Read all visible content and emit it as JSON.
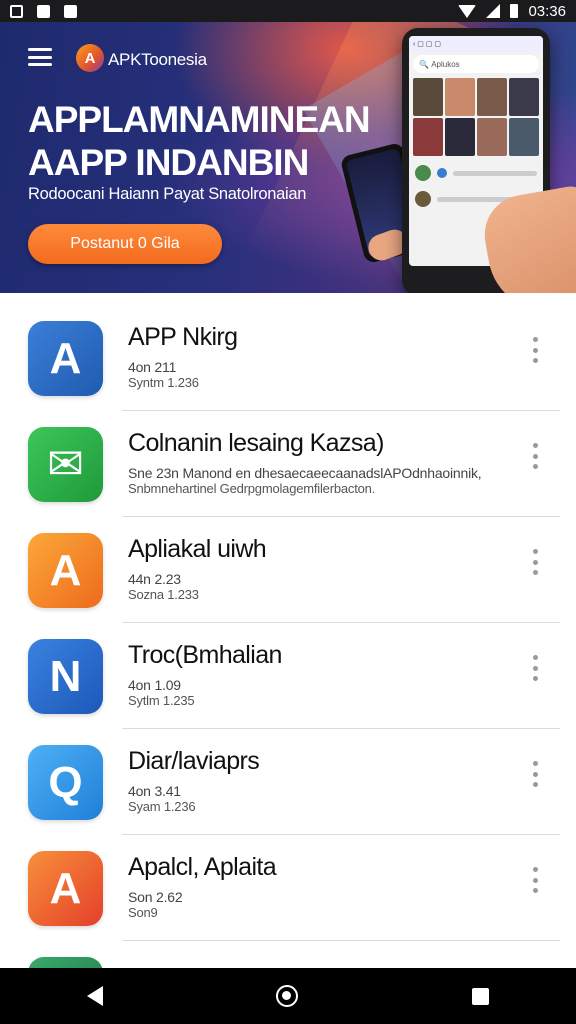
{
  "status_bar": {
    "time": "03:36"
  },
  "header": {
    "brand": "APKToonesia"
  },
  "hero": {
    "title": "APPLAMNAMINEAN\nAAPP INDANBIN",
    "subtitle": "Rodoocani Haiann Payat Snatolronaian",
    "cta_label": "Postanut 0 Gila",
    "phone": {
      "search_text": "Aplukos"
    }
  },
  "apps": [
    {
      "name": "APP Nkirg",
      "meta1": "4on 211",
      "meta2": "Syntm 1.236",
      "icon": "a-logo-icon",
      "color": "#2f6fc9"
    },
    {
      "name": "Colnanin lesaing Kazsa)",
      "meta1": "Sne 23n Manond en dhesaecaeecaanadslAPOdnhaoinnik,",
      "meta2": "Snbmnehartinel Gedrpgmolagemfilerbacton.",
      "icon": "green-envelope-icon",
      "color": "#2fae46"
    },
    {
      "name": "Apliakal uiwh",
      "meta1": "44n 2.23",
      "meta2": "Sozna 1.233",
      "icon": "a-triangle-icon",
      "color": "#f18a23"
    },
    {
      "name": "Troc(Bmhalian",
      "meta1": "4on 1.09",
      "meta2": "Sytlm 1.235",
      "icon": "n-logo-icon",
      "color": "#2b6fd1"
    },
    {
      "name": "Diar/laviaprs",
      "meta1": "4on 3.41",
      "meta2": "Syam 1.236",
      "icon": "q-search-icon",
      "color": "#2f95e8"
    },
    {
      "name": "Apalcl, Aplaita",
      "meta1": "Son 2.62",
      "meta2": "Son9",
      "icon": "a-color-icon",
      "color": "#ef5a2a"
    }
  ]
}
